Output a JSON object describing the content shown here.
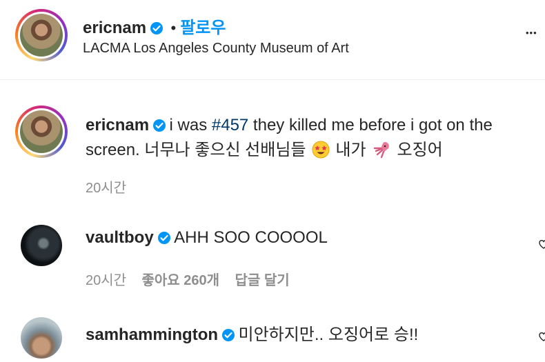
{
  "header": {
    "username": "ericnam",
    "dot": "•",
    "follow_label": "팔로우",
    "location": "LACMA Los Angeles County Museum of Art",
    "more_label": "•••"
  },
  "caption": {
    "username": "ericnam",
    "text_before": "i was ",
    "hashtag": "#457",
    "text_after_line1": " they killed me before i got on the",
    "line2_text": "screen. 너무나 좋으신 선배님들",
    "line2_mid": "내가",
    "line2_end": "오징어",
    "time": "20시간"
  },
  "comments": [
    {
      "username": "vaultboy",
      "text": "AHH SOO COOOOL",
      "time": "20시간",
      "likes": "좋아요 260개",
      "reply": "답글 달기"
    },
    {
      "username": "samhammington",
      "text": "미안하지만.. 오징어로 승!!"
    }
  ],
  "colors": {
    "follow": "#0095f6",
    "verified": "#0095f6",
    "hashtag": "#00376b",
    "meta": "#8e8e8e"
  }
}
